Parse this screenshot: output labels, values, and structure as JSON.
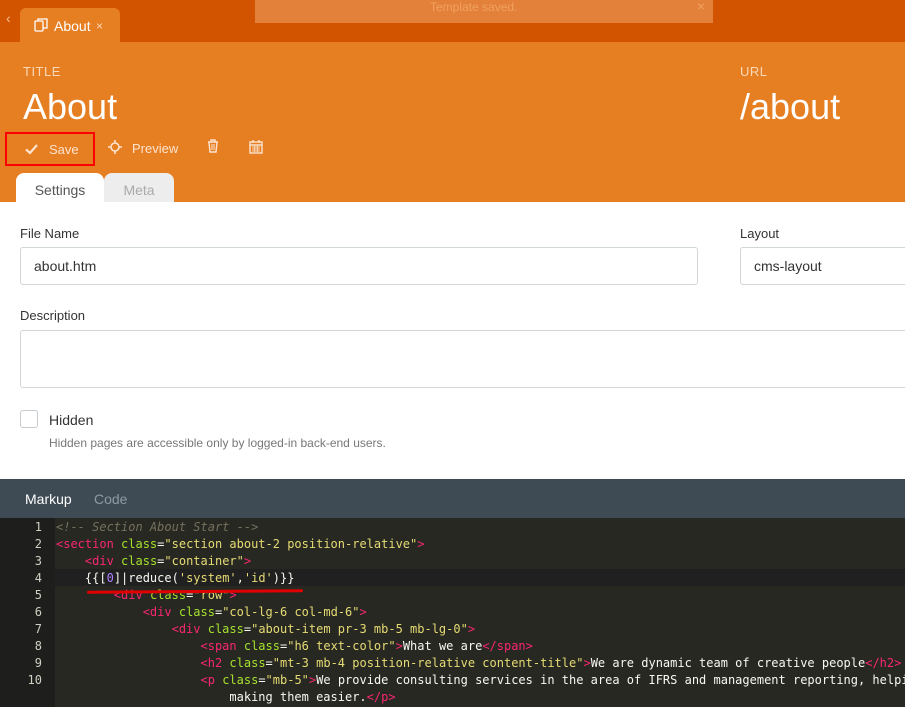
{
  "header": {
    "doc_tab": {
      "label": "About",
      "close": "×"
    },
    "flash": {
      "text": "Template saved.",
      "close": "×"
    },
    "title_label": "TITLE",
    "title_value": "About",
    "url_label": "URL",
    "url_value": "/about",
    "toolbar": {
      "save_label": "Save",
      "preview_label": "Preview",
      "icons": {
        "save": "check-icon",
        "preview": "crosshair-icon",
        "delete": "trash-icon",
        "date": "calendar-icon"
      }
    },
    "tabs": [
      {
        "label": "Settings",
        "active": true
      },
      {
        "label": "Meta",
        "active": false
      }
    ]
  },
  "form": {
    "file_name_label": "File Name",
    "file_name_value": "about.htm",
    "layout_label": "Layout",
    "layout_value": "cms-layout",
    "description_label": "Description",
    "description_value": "",
    "hidden_label": "Hidden",
    "hidden_checked": false,
    "hidden_help": "Hidden pages are accessible only by logged-in back-end users."
  },
  "editor": {
    "tabs": [
      {
        "label": "Markup",
        "active": true
      },
      {
        "label": "Code",
        "active": false
      }
    ],
    "line_numbers": [
      "1",
      "2",
      "3",
      "4",
      "5",
      "6",
      "7",
      "8",
      "9",
      "10"
    ],
    "lines": [
      "<!-- Section About Start -->",
      "<section class=\"section about-2 position-relative\">",
      "    <div class=\"container\">",
      "    {{[0]|reduce('system','id')}}",
      "        <div class=\"row\">",
      "            <div class=\"col-lg-6 col-md-6\">",
      "                <div class=\"about-item pr-3 mb-5 mb-lg-0\">",
      "                    <span class=\"h6 text-color\">What we are</span>",
      "                    <h2 class=\"mt-3 mb-4 position-relative content-title\">We are dynamic team of creative people</h2>",
      "                    <p class=\"mb-5\">We provide consulting services in the area of IFRS and management reporting, helpi",
      "                        making them easier.</p>"
    ]
  },
  "colors": {
    "brand_orange": "#e67e22",
    "brand_orange_dark": "#d35400",
    "editor_bg": "#272822",
    "highlight_red": "#e10000"
  }
}
